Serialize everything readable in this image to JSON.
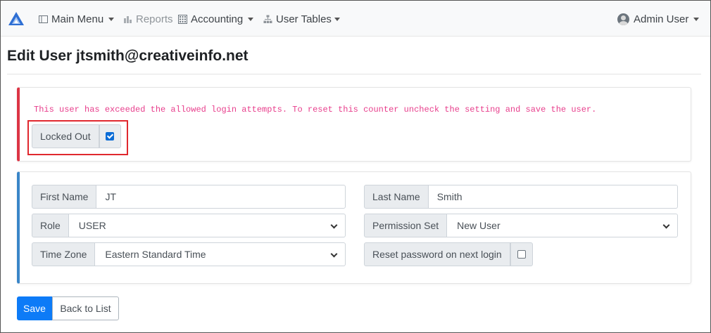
{
  "navbar": {
    "main_menu": "Main Menu",
    "reports": "Reports",
    "accounting": "Accounting",
    "user_tables": "User Tables",
    "user": "Admin User"
  },
  "page": {
    "title": "Edit User jtsmith@creativeinfo.net"
  },
  "lockout": {
    "message": "This user has exceeded the allowed login attempts. To reset this counter uncheck the setting and save the user.",
    "label": "Locked Out",
    "checked": true
  },
  "form": {
    "first_name_label": "First Name",
    "first_name_value": "JT",
    "last_name_label": "Last Name",
    "last_name_value": "Smith",
    "role_label": "Role",
    "role_value": "USER",
    "permission_set_label": "Permission Set",
    "permission_set_value": "New User",
    "time_zone_label": "Time Zone",
    "time_zone_value": "Eastern Standard Time",
    "reset_password_label": "Reset password on next login",
    "reset_password_checked": false
  },
  "actions": {
    "save": "Save",
    "back": "Back to List"
  },
  "colors": {
    "primary": "#0d7bf7",
    "danger": "#dc3545",
    "info_border": "#3a86c8",
    "warning_text": "#e83e8c"
  }
}
